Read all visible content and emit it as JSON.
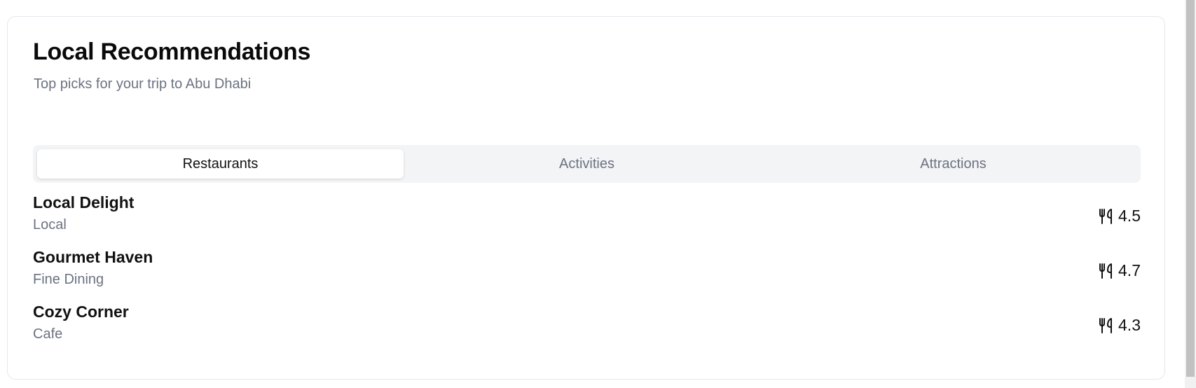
{
  "header": {
    "title": "Local Recommendations",
    "subtitle": "Top picks for your trip to Abu Dhabi"
  },
  "tabs": [
    {
      "label": "Restaurants",
      "active": true
    },
    {
      "label": "Activities",
      "active": false
    },
    {
      "label": "Attractions",
      "active": false
    }
  ],
  "restaurants": [
    {
      "name": "Local Delight",
      "type": "Local",
      "rating": "4.5",
      "icon": "utensils-icon"
    },
    {
      "name": "Gourmet Haven",
      "type": "Fine Dining",
      "rating": "4.7",
      "icon": "utensils-icon"
    },
    {
      "name": "Cozy Corner",
      "type": "Cafe",
      "rating": "4.3",
      "icon": "utensils-icon"
    }
  ]
}
